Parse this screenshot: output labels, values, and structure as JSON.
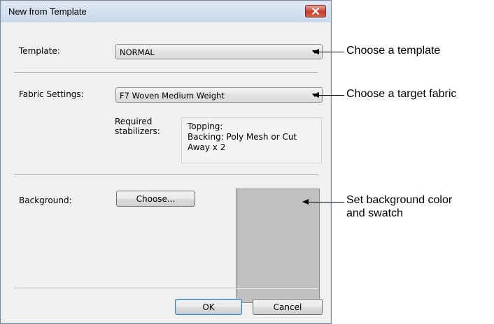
{
  "dialog": {
    "title": "New from Template",
    "close_icon": "close-icon",
    "template_label": "Template:",
    "template_value": "NORMAL",
    "fabric_label": "Fabric Settings:",
    "fabric_value": "F7 Woven Medium Weight",
    "stabilizers_label_line1": "Required",
    "stabilizers_label_line2": "stabilizers:",
    "stabilizers_lines": [
      "Topping:",
      "Backing: Poly Mesh or Cut",
      "Away x 2"
    ],
    "background_label": "Background:",
    "choose_button": "Choose...",
    "swatch_color": "#c0c0c0",
    "ok_button": "OK",
    "cancel_button": "Cancel"
  },
  "annotations": {
    "template": "Choose a template",
    "fabric": "Choose a target fabric",
    "background_line1": "Set background color",
    "background_line2": "and swatch"
  }
}
